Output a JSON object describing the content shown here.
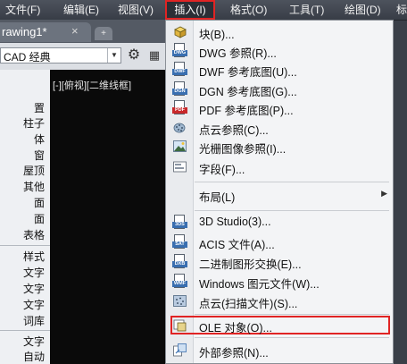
{
  "menubar": {
    "items": [
      {
        "label": "文件(F)"
      },
      {
        "label": "编辑(E)"
      },
      {
        "label": "视图(V)"
      },
      {
        "label": "插入(I)"
      },
      {
        "label": "格式(O)"
      },
      {
        "label": "工具(T)"
      },
      {
        "label": "绘图(D)"
      },
      {
        "label": "标"
      }
    ],
    "active_index": 3
  },
  "document_tab": {
    "title": "rawing1*",
    "close": "×",
    "new_tab": "+"
  },
  "workspace": {
    "value": "CAD 经典"
  },
  "left_panel": {
    "items": [
      "置",
      "柱子",
      "体",
      "窗",
      "屋顶",
      "其他",
      "面",
      "面",
      "表格",
      "样式",
      "文字",
      "文字",
      "文字",
      "词库",
      "文字",
      "自动"
    ]
  },
  "viewport": {
    "label": "[-][俯视][二维线框]"
  },
  "insert_menu": {
    "items": [
      {
        "label": "块(B)...",
        "icon": "block-icon"
      },
      {
        "label": "DWG 参照(R)...",
        "icon": "dwg-icon"
      },
      {
        "label": "DWF 参考底图(U)...",
        "icon": "dwf-icon"
      },
      {
        "label": "DGN 参考底图(G)...",
        "icon": "dgn-icon"
      },
      {
        "label": "PDF 参考底图(P)...",
        "icon": "pdf-icon"
      },
      {
        "label": "点云参照(C)...",
        "icon": "point-cloud-icon"
      },
      {
        "label": "光栅图像参照(I)...",
        "icon": "raster-image-icon"
      },
      {
        "label": "字段(F)...",
        "icon": "field-icon"
      },
      {
        "label": "布局(L)",
        "submenu": "▶"
      },
      {
        "label": "3D Studio(3)...",
        "icon": "3ds-icon"
      },
      {
        "label": "ACIS 文件(A)...",
        "icon": "acis-icon"
      },
      {
        "label": "二进制图形交换(E)...",
        "icon": "dxb-icon"
      },
      {
        "label": "Windows 图元文件(W)...",
        "icon": "wmf-icon"
      },
      {
        "label": "点云(扫描文件)(S)...",
        "icon": "point-cloud-scan-icon"
      },
      {
        "label": "OLE 对象(O)...",
        "icon": "ole-icon",
        "highlighted": true
      },
      {
        "label": "外部参照(N)...",
        "icon": "xref-icon"
      }
    ]
  },
  "colors": {
    "highlight": "#e02424",
    "menubar": "#3f444d",
    "canvas": "#0a0a0a"
  }
}
